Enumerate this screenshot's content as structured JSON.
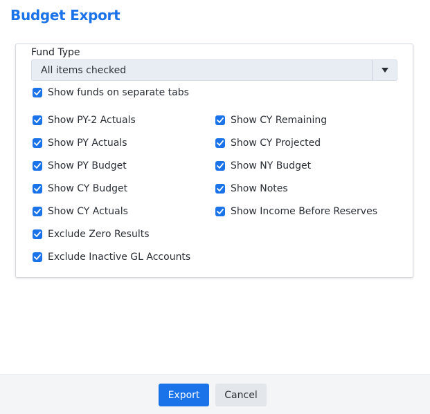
{
  "dialog": {
    "title": "Budget Export"
  },
  "fund_type": {
    "label": "Fund Type",
    "selected": "All items checked",
    "separate_tabs": {
      "label": "Show funds on separate tabs",
      "checked": true
    }
  },
  "options": {
    "left": [
      {
        "label": "Show PY-2 Actuals",
        "checked": true
      },
      {
        "label": "Show PY Actuals",
        "checked": true
      },
      {
        "label": "Show PY Budget",
        "checked": true
      },
      {
        "label": "Show CY Budget",
        "checked": true
      },
      {
        "label": "Show CY Actuals",
        "checked": true
      },
      {
        "label": "Exclude Zero Results",
        "checked": true
      },
      {
        "label": "Exclude Inactive GL Accounts",
        "checked": true
      }
    ],
    "right": [
      {
        "label": "Show CY Remaining",
        "checked": true
      },
      {
        "label": "Show CY Projected",
        "checked": true
      },
      {
        "label": "Show NY Budget",
        "checked": true
      },
      {
        "label": "Show Notes",
        "checked": true
      },
      {
        "label": "Show Income Before Reserves",
        "checked": true
      }
    ]
  },
  "footer": {
    "export_label": "Export",
    "cancel_label": "Cancel"
  },
  "colors": {
    "accent": "#1a73e8",
    "select_bg": "#e8edf4",
    "footer_bg": "#f4f5f7"
  },
  "icons": {
    "checkbox": "checkmark-icon",
    "dropdown": "caret-down-icon"
  }
}
